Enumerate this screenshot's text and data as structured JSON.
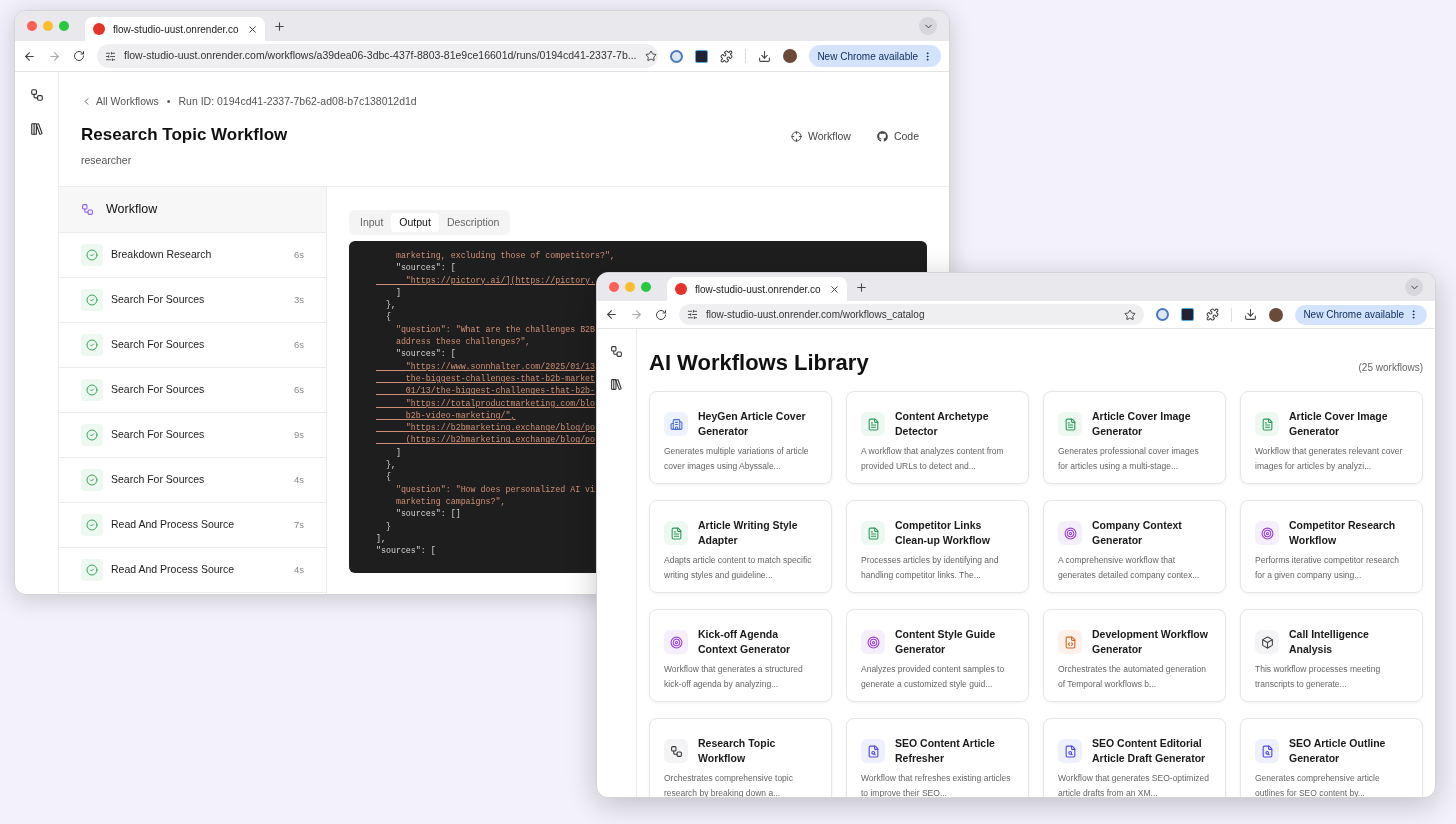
{
  "run_window": {
    "tab": {
      "title": "flow-studio-uust.onrender.co"
    },
    "address": "flow-studio-uust.onrender.com/workflows/a39dea06-3dbc-437f-8803-81e9ce16601d/runs/0194cd41-2337-7b...",
    "update_button": "New Chrome available",
    "breadcrumb": {
      "back_link": "All Workflows",
      "separator": "•",
      "run_id": "Run ID: 0194cd41-2337-7b62-ad08-b7c138012d1d"
    },
    "title": "Research Topic Workflow",
    "subtitle": "researcher",
    "actions": [
      {
        "kind": "workflow",
        "label": "Workflow"
      },
      {
        "kind": "code",
        "label": "Code"
      }
    ],
    "steps_panel": {
      "title": "Workflow",
      "steps": [
        {
          "name": "Breakdown Research",
          "duration": "6s",
          "done": true
        },
        {
          "name": "Search For Sources",
          "duration": "3s",
          "done": true
        },
        {
          "name": "Search For Sources",
          "duration": "6s",
          "done": true
        },
        {
          "name": "Search For Sources",
          "duration": "6s",
          "done": true
        },
        {
          "name": "Search For Sources",
          "duration": "9s",
          "done": true
        },
        {
          "name": "Search For Sources",
          "duration": "4s",
          "done": true
        },
        {
          "name": "Read And Process Source",
          "duration": "7s",
          "done": true
        },
        {
          "name": "Read And Process Source",
          "duration": "4s",
          "done": true
        }
      ]
    },
    "detail_tabs": [
      {
        "label": "Input",
        "selected": false
      },
      {
        "label": "Output",
        "selected": true
      },
      {
        "label": "Description",
        "selected": false
      }
    ],
    "code_lines": [
      {
        "kind": "string",
        "text": "    marketing, excluding those of competitors?\","
      },
      {
        "kind": "key",
        "text": "    \"sources\": ["
      },
      {
        "kind": "url",
        "text": "      \"https://pictory.ai/](https://pictory."
      },
      {
        "kind": "key",
        "text": "    ]"
      },
      {
        "kind": "key",
        "text": "  },"
      },
      {
        "kind": "key",
        "text": "  {"
      },
      {
        "kind": "string",
        "text": "    \"question\": \"What are the challenges B2B"
      },
      {
        "kind": "string",
        "text": "    address these challenges?\","
      },
      {
        "kind": "key",
        "text": "    \"sources\": ["
      },
      {
        "kind": "url",
        "text": "      \"https://www.sonnhalter.com/2025/01/13"
      },
      {
        "kind": "url",
        "text": "      the-biggest-challenges-that-b2b-market"
      },
      {
        "kind": "url",
        "text": "      01/13/the-biggest-challenges-that-b2b-"
      },
      {
        "kind": "url",
        "text": "      \"https://totalproductmarketing.com/blo"
      },
      {
        "kind": "url",
        "text": "      b2b-video-marketing/\","
      },
      {
        "kind": "url",
        "text": "      \"https://b2bmarketing.exchange/blog/po"
      },
      {
        "kind": "url",
        "text": "      (https://b2bmarketing.exchange/blog/po"
      },
      {
        "kind": "key",
        "text": "    ]"
      },
      {
        "kind": "key",
        "text": "  },"
      },
      {
        "kind": "key",
        "text": "  {"
      },
      {
        "kind": "string",
        "text": "    \"question\": \"How does personalized AI vi"
      },
      {
        "kind": "string",
        "text": "    marketing campaigns?\","
      },
      {
        "kind": "key",
        "text": "    \"sources\": []"
      },
      {
        "kind": "key",
        "text": "  }"
      },
      {
        "kind": "key",
        "text": "],"
      },
      {
        "kind": "key",
        "text": "\"sources\": ["
      }
    ]
  },
  "catalog_window": {
    "tab": {
      "title": "flow-studio-uust.onrender.co"
    },
    "address": "flow-studio-uust.onrender.com/workflows_catalog",
    "update_button": "New Chrome available",
    "title": "AI Workflows Library",
    "count": "(25 workflows)",
    "cards": [
      {
        "kind": "building",
        "title": "HeyGen Article Cover Generator",
        "description": "Generates multiple variations of article cover images using Abyssale..."
      },
      {
        "kind": "document",
        "title": "Content Archetype Detector",
        "description": "A workflow that analyzes content from provided URLs to detect and..."
      },
      {
        "kind": "document",
        "title": "Article Cover Image Generator",
        "description": "Generates professional cover images for articles using a multi-stage..."
      },
      {
        "kind": "document",
        "title": "Article Cover Image Generator",
        "description": "Workflow that generates relevant cover images for articles by analyzi..."
      },
      {
        "kind": "document",
        "title": "Article Writing Style Adapter",
        "description": "Adapts article content to match specific writing styles and guideline..."
      },
      {
        "kind": "document",
        "title": "Competitor Links Clean-up Workflow",
        "description": "Processes articles by identifying and handling competitor links. The..."
      },
      {
        "kind": "target",
        "title": "Company Context Generator",
        "description": "A comprehensive workflow that generates detailed company contex..."
      },
      {
        "kind": "target",
        "title": "Competitor Research Workflow",
        "description": "Performs iterative competitor research for a given company using..."
      },
      {
        "kind": "target",
        "title": "Kick-off Agenda Context Generator",
        "description": "Workflow that generates a structured kick-off agenda by analyzing..."
      },
      {
        "kind": "target",
        "title": "Content Style Guide Generator",
        "description": "Analyzes provided content samples to generate a customized style guid..."
      },
      {
        "kind": "code",
        "title": "Development Workflow Generator",
        "description": "Orchestrates the automated generation of Temporal workflows b..."
      },
      {
        "kind": "cube",
        "title": "Call Intelligence Analysis",
        "description": "This workflow processes meeting transcripts to generate..."
      },
      {
        "kind": "flow",
        "title": "Research Topic Workflow",
        "description": "Orchestrates comprehensive topic research by breaking down a..."
      },
      {
        "kind": "seo",
        "title": "SEO Content Article Refresher",
        "description": "Workflow that refreshes existing articles to improve their SEO..."
      },
      {
        "kind": "seo",
        "title": "SEO Content Editorial Article Draft Generator",
        "description": "Workflow that generates SEO-optimized article drafts from an XM..."
      },
      {
        "kind": "seo",
        "title": "SEO Article Outline Generator",
        "description": "Generates comprehensive article outlines for SEO content by..."
      }
    ]
  }
}
